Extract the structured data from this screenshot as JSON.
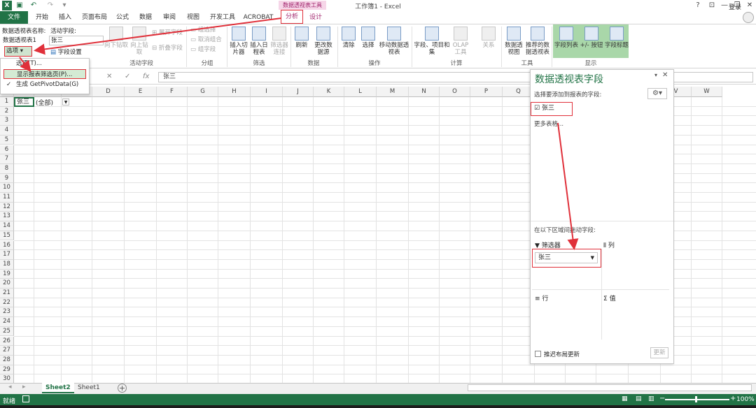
{
  "window": {
    "title": "工作簿1 - Excel",
    "context_tab_group": "数据透视表工具",
    "login_label": "登录",
    "buttons": {
      "help": "?",
      "min": "—",
      "restore": "❐",
      "close": "✕"
    }
  },
  "tabs": [
    "文件",
    "开始",
    "插入",
    "页面布局",
    "公式",
    "数据",
    "审阅",
    "视图",
    "开发工具",
    "ACROBAT",
    "分析",
    "设计"
  ],
  "active_tab": "分析",
  "ribbon": {
    "pivottable_name_label": "数据透视表名称:",
    "pivottable_name": "数据透视表1",
    "active_field_label": "活动字段:",
    "active_field_value": "张三",
    "options_button": "选项",
    "field_settings": "字段设置",
    "drill_down": "向下钻取",
    "drill_up": "向上钻取",
    "expand_field": "展开字段",
    "collapse_field": "折叠字段",
    "group_selection": "组选择",
    "ungroup": "取消组合",
    "group_field": "组字段",
    "insert_slicer": "插入切片器",
    "insert_timeline": "插入日程表",
    "filter_connections": "筛选器连接",
    "refresh": "刷新",
    "change_source": "更改数据源",
    "clear": "清除",
    "select": "选择",
    "move_pivot": "移动数据透视表",
    "fields_items_sets": "字段、项目和集",
    "olap_tools": "OLAP 工具",
    "relationships": "关系",
    "pivot_chart": "数据透视图",
    "recommended": "推荐的数据透视表",
    "field_list": "字段列表",
    "buttons_toggle": "+/- 按钮",
    "field_headers": "字段标题",
    "groups": [
      "活动字段",
      "分组",
      "筛选",
      "数据",
      "操作",
      "计算",
      "工具",
      "显示"
    ]
  },
  "options_menu": {
    "items": [
      "选项(T)...",
      "显示报表筛选页(P)...",
      "生成 GetPivotData(G)"
    ]
  },
  "formula_bar": {
    "value": "张三"
  },
  "columns": [
    "A",
    "B",
    "C",
    "D",
    "E",
    "F",
    "G",
    "H",
    "I",
    "J",
    "K",
    "L",
    "M",
    "N",
    "O",
    "P",
    "Q",
    "R",
    "S",
    "T",
    "U",
    "V",
    "W"
  ],
  "rows": [
    "1",
    "2",
    "3",
    "4",
    "5",
    "6",
    "7",
    "8",
    "9",
    "10",
    "11",
    "12",
    "13",
    "14",
    "15",
    "16",
    "17",
    "18",
    "19",
    "20",
    "21",
    "22",
    "23",
    "24",
    "25",
    "26",
    "27",
    "28",
    "29",
    "30"
  ],
  "cells": {
    "a1": "张三",
    "b1": "(全部)"
  },
  "sheets": [
    "Sheet2",
    "Sheet1"
  ],
  "status": {
    "ready": "就绪",
    "zoom": "100%"
  },
  "pivot_pane": {
    "title": "数据透视表字段",
    "chooser_label": "选择要添加到报表的字段:",
    "field": "张三",
    "more_tables": "更多表格...",
    "drag_label": "在以下区域间拖动字段:",
    "filters": "筛选器",
    "columns": "列",
    "rows": "行",
    "values": "值",
    "filter_field": "张三",
    "defer_label": "推迟布局更新",
    "update": "更新"
  }
}
